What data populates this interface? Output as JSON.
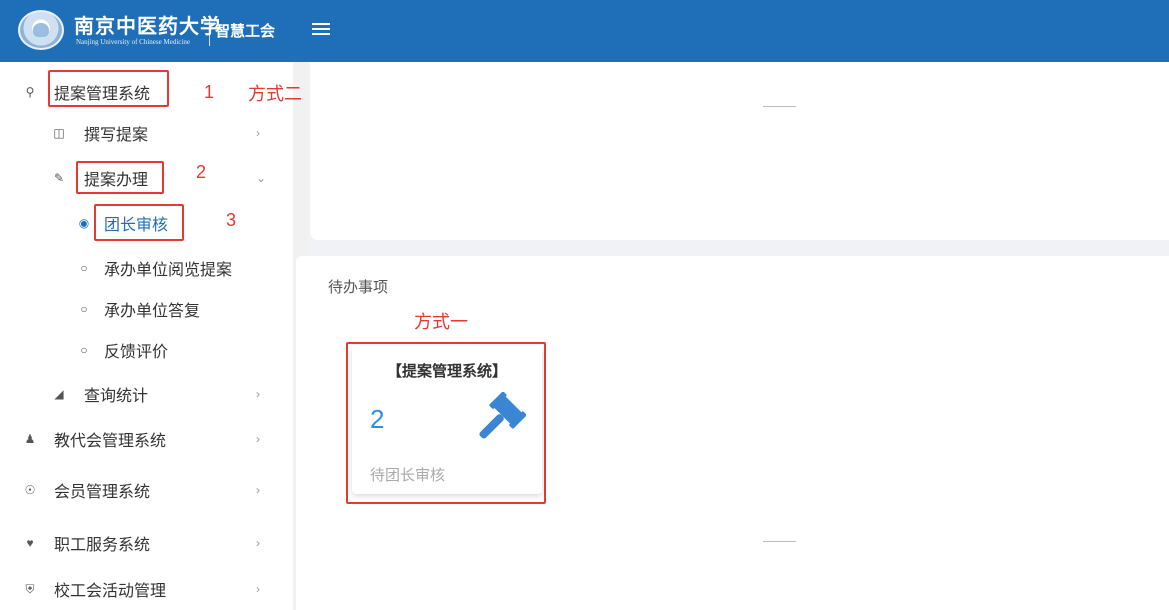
{
  "header": {
    "brand_cn": "南京中医药大学",
    "brand_en": "Nanjing University of Chinese Medicine",
    "system_name": "智慧工会",
    "menu_icon": "hamburger-icon",
    "color": "#1e6fb8"
  },
  "sidebar": {
    "items": [
      {
        "label": "提案管理系统",
        "icon": "lightbulb-icon"
      },
      {
        "label": "撰写提案",
        "icon": "columns-icon"
      },
      {
        "label": "提案办理",
        "icon": "edit-icon"
      },
      {
        "label": "团长审核",
        "icon": "radio-checked-icon"
      },
      {
        "label": "承办单位阅览提案",
        "icon": "radio-icon"
      },
      {
        "label": "承办单位答复",
        "icon": "radio-icon"
      },
      {
        "label": "反馈评价",
        "icon": "radio-icon"
      },
      {
        "label": "查询统计",
        "icon": "area-chart-icon"
      },
      {
        "label": "教代会管理系统",
        "icon": "users-icon"
      },
      {
        "label": "会员管理系统",
        "icon": "user-circle-icon"
      },
      {
        "label": "职工服务系统",
        "icon": "heart-icon"
      },
      {
        "label": "校工会活动管理",
        "icon": "shield-icon"
      }
    ]
  },
  "main": {
    "todo_title": "待办事项",
    "card": {
      "title": "【提案管理系统】",
      "count": "2",
      "subtitle": "待团长审核",
      "icon": "gavel-icon",
      "count_color": "#2d8fe0"
    }
  },
  "annotations": {
    "n1": "1",
    "n2": "2",
    "n3": "3",
    "method2": "方式二",
    "method1": "方式一",
    "color": "#e53935"
  }
}
